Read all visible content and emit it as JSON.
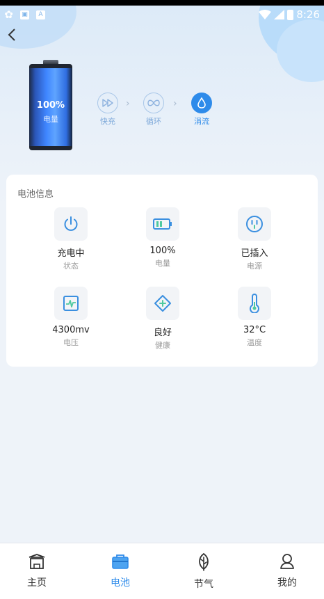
{
  "status_bar": {
    "time": "8:26",
    "left_icons": [
      "aperture-icon",
      "screenshot-icon",
      "a-icon"
    ],
    "right_icons": [
      "wifi-icon",
      "signal-icon",
      "battery-charging-icon"
    ]
  },
  "battery": {
    "percent": "100%",
    "label": "电量",
    "level": 1.0
  },
  "modes": [
    {
      "name": "fast",
      "label": "快充",
      "active": false
    },
    {
      "name": "cycle",
      "label": "循环",
      "active": false
    },
    {
      "name": "trickle",
      "label": "涓流",
      "active": true
    }
  ],
  "info": {
    "title": "电池信息",
    "items": [
      {
        "icon": "power-icon",
        "value": "充电中",
        "label": "状态"
      },
      {
        "icon": "battery-icon",
        "value": "100%",
        "label": "电量"
      },
      {
        "icon": "plug-icon",
        "value": "已插入",
        "label": "电源"
      },
      {
        "icon": "voltage-icon",
        "value": "4300mv",
        "label": "电压"
      },
      {
        "icon": "health-icon",
        "value": "良好",
        "label": "健康"
      },
      {
        "icon": "thermometer-icon",
        "value": "32°C",
        "label": "温度"
      }
    ]
  },
  "tabs": [
    {
      "icon": "home-icon",
      "label": "主页",
      "active": false
    },
    {
      "icon": "battery-tab-icon",
      "label": "电池",
      "active": true
    },
    {
      "icon": "leaf-icon",
      "label": "节气",
      "active": false
    },
    {
      "icon": "user-icon",
      "label": "我的",
      "active": false
    }
  ],
  "colors": {
    "accent": "#2e8bea",
    "mode_inactive": "#7ea9da",
    "icon_blue": "#3a8fe0"
  }
}
